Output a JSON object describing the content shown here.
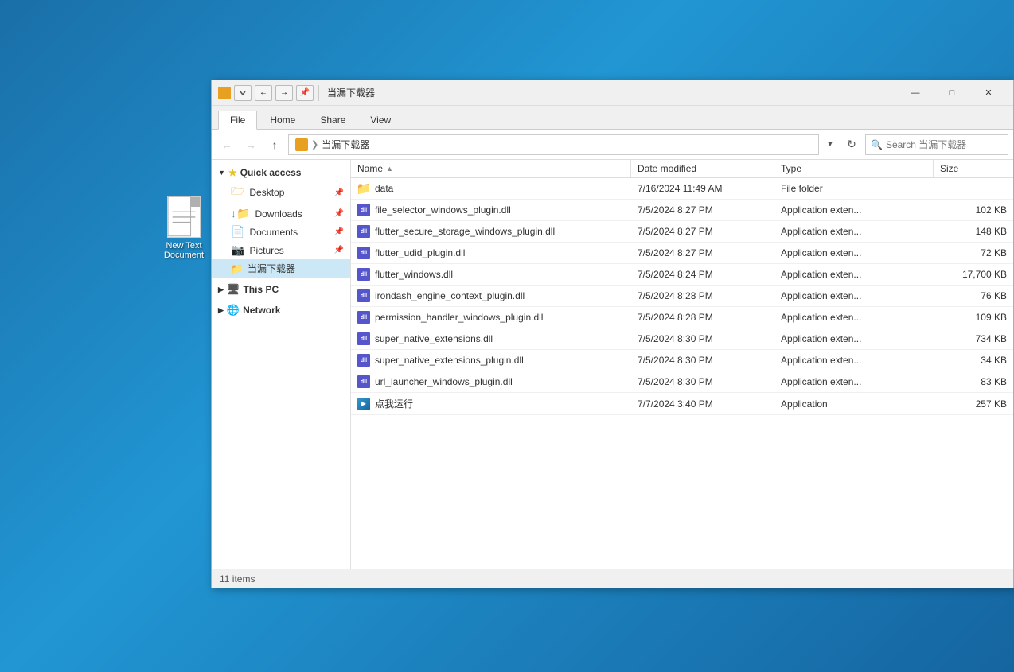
{
  "desktop": {
    "icon": {
      "label_line1": "New Text",
      "label_line2": "Document"
    }
  },
  "window": {
    "title": "当漏下载器",
    "ribbon": {
      "tabs": [
        "File",
        "Home",
        "Share",
        "View"
      ]
    },
    "address": {
      "path": "当漏下载器",
      "search_placeholder": "Search 当漏下载器"
    },
    "sidebar": {
      "quick_access_label": "Quick access",
      "items": [
        {
          "label": "Desktop",
          "pinned": true
        },
        {
          "label": "Downloads",
          "pinned": true
        },
        {
          "label": "Documents",
          "pinned": true
        },
        {
          "label": "Pictures",
          "pinned": true
        },
        {
          "label": "当漏下载器",
          "pinned": false
        }
      ],
      "this_pc_label": "This PC",
      "network_label": "Network"
    },
    "columns": [
      "Name",
      "Date modified",
      "Type",
      "Size"
    ],
    "files": [
      {
        "name": "data",
        "type": "folder",
        "modified": "7/16/2024 11:49 AM",
        "kind": "File folder",
        "size": ""
      },
      {
        "name": "file_selector_windows_plugin.dll",
        "type": "dll",
        "modified": "7/5/2024 8:27 PM",
        "kind": "Application exten...",
        "size": "102 KB"
      },
      {
        "name": "flutter_secure_storage_windows_plugin.dll",
        "type": "dll",
        "modified": "7/5/2024 8:27 PM",
        "kind": "Application exten...",
        "size": "148 KB"
      },
      {
        "name": "flutter_udid_plugin.dll",
        "type": "dll",
        "modified": "7/5/2024 8:27 PM",
        "kind": "Application exten...",
        "size": "72 KB"
      },
      {
        "name": "flutter_windows.dll",
        "type": "dll",
        "modified": "7/5/2024 8:24 PM",
        "kind": "Application exten...",
        "size": "17,700 KB"
      },
      {
        "name": "irondash_engine_context_plugin.dll",
        "type": "dll",
        "modified": "7/5/2024 8:28 PM",
        "kind": "Application exten...",
        "size": "76 KB"
      },
      {
        "name": "permission_handler_windows_plugin.dll",
        "type": "dll",
        "modified": "7/5/2024 8:28 PM",
        "kind": "Application exten...",
        "size": "109 KB"
      },
      {
        "name": "super_native_extensions.dll",
        "type": "dll",
        "modified": "7/5/2024 8:30 PM",
        "kind": "Application exten...",
        "size": "734 KB"
      },
      {
        "name": "super_native_extensions_plugin.dll",
        "type": "dll",
        "modified": "7/5/2024 8:30 PM",
        "kind": "Application exten...",
        "size": "34 KB"
      },
      {
        "name": "url_launcher_windows_plugin.dll",
        "type": "dll",
        "modified": "7/5/2024 8:30 PM",
        "kind": "Application exten...",
        "size": "83 KB"
      },
      {
        "name": "点我运行",
        "type": "exe",
        "modified": "7/7/2024 3:40 PM",
        "kind": "Application",
        "size": "257 KB"
      }
    ],
    "status": "11 items"
  }
}
